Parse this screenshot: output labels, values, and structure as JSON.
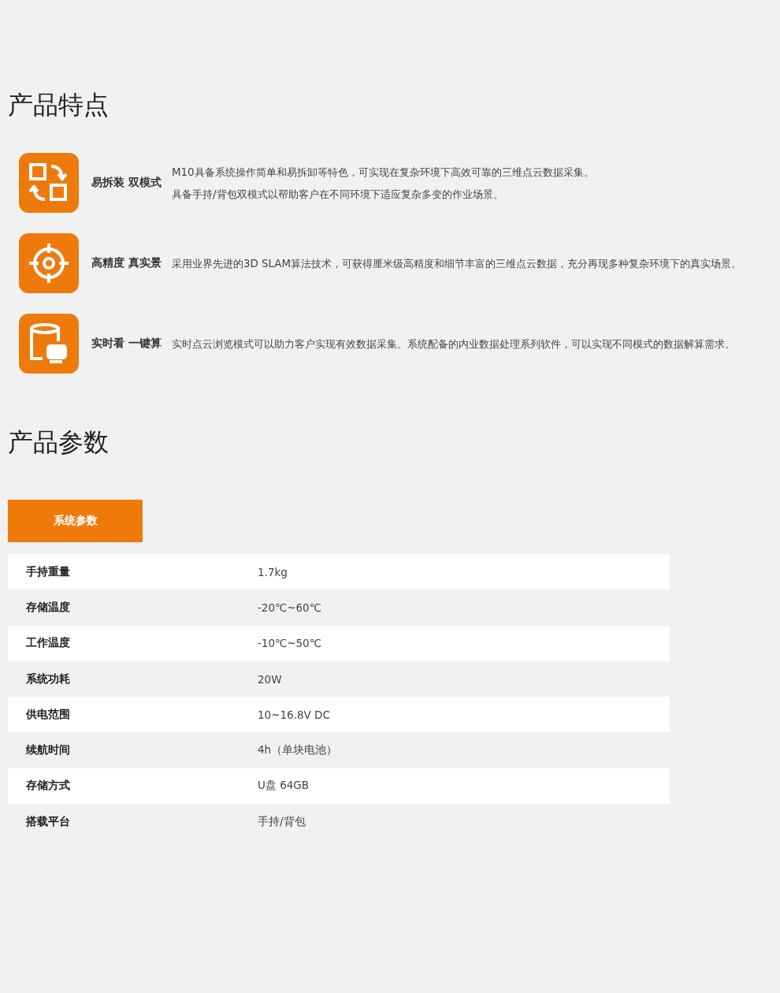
{
  "features_section": {
    "title": "产品特点",
    "features": [
      {
        "label": "易拆装 双模式",
        "lines": [
          "M10具备系统操作简单和易拆卸等特色，可实现在复杂环境下高效可靠的三维点云数据采集。",
          "具备手持/背包双模式以帮助客户在不同环境下适应复杂多变的作业场景。"
        ]
      },
      {
        "label": "高精度 真实景",
        "lines": [
          "采用业界先进的3D SLAM算法技术，可获得厘米级高精度和细节丰富的三维点云数据，充分再现多种复杂环境下的真实场景。"
        ]
      },
      {
        "label": "实时看 一键算",
        "lines": [
          "实时点云浏览模式可以助力客户实现有效数据采集。系统配备的内业数据处理系列软件，可以实现不同模式的数据解算需求。"
        ]
      }
    ]
  },
  "specs_section": {
    "title": "产品参数",
    "tabs": [
      {
        "label": "系统参数",
        "selected": true
      }
    ],
    "rows": [
      {
        "name": "手持重量",
        "value": "1.7kg"
      },
      {
        "name": "存储温度",
        "value": "-20℃~60℃"
      },
      {
        "name": "工作温度",
        "value": "-10℃~50℃"
      },
      {
        "name": "系统功耗",
        "value": "20W"
      },
      {
        "name": "供电范围",
        "value": "10~16.8V DC"
      },
      {
        "name": "续航时间",
        "value": "4h（单块电池）"
      },
      {
        "name": "存储方式",
        "value": "U盘 64GB"
      },
      {
        "name": "搭载平台",
        "value": "手持/背包"
      }
    ]
  }
}
